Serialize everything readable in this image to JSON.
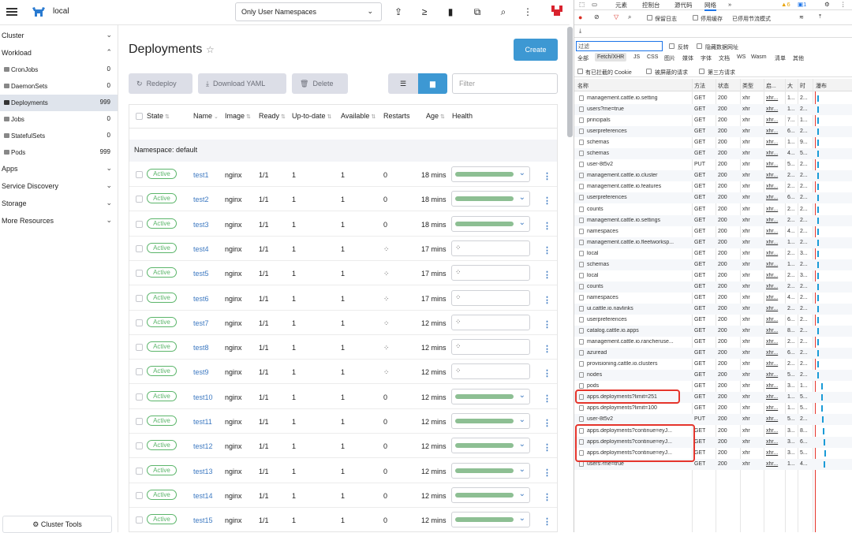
{
  "topbar": {
    "cluster_name": "local",
    "namespace_filter": "Only User Namespaces",
    "icons": [
      "upload-icon",
      "terminal-icon",
      "file-icon",
      "copy-icon",
      "search-icon",
      "more-vertical-icon"
    ]
  },
  "sidebar": {
    "groups": [
      {
        "label": "Cluster",
        "chevron": "⌄"
      },
      {
        "label": "Workload",
        "chevron": "⌃"
      },
      {
        "label": "Apps",
        "chevron": "⌄"
      },
      {
        "label": "Service Discovery",
        "chevron": "⌄"
      },
      {
        "label": "Storage",
        "chevron": "⌄"
      },
      {
        "label": "More Resources",
        "chevron": "⌄"
      }
    ],
    "items": [
      {
        "label": "CronJobs",
        "count": "0"
      },
      {
        "label": "DaemonSets",
        "count": "0"
      },
      {
        "label": "Deployments",
        "count": "999"
      },
      {
        "label": "Jobs",
        "count": "0"
      },
      {
        "label": "StatefulSets",
        "count": "0"
      },
      {
        "label": "Pods",
        "count": "999"
      }
    ],
    "cluster_tools": "Cluster Tools"
  },
  "main": {
    "title": "Deployments",
    "star": "☆",
    "create_label": "Create",
    "redeploy_label": "Redeploy",
    "download_label": "Download YAML",
    "delete_label": "Delete",
    "filter_placeholder": "Filter",
    "columns": [
      "State",
      "Name",
      "Image",
      "Ready",
      "Up-to-date",
      "Available",
      "Restarts",
      "Age",
      "Health"
    ],
    "namespace_label": "Namespace:",
    "namespace_value": "default",
    "rows": [
      {
        "state": "Active",
        "name": "test1",
        "image": "nginx",
        "ready": "1/1",
        "uptodate": "1",
        "available": "1",
        "restarts": "0",
        "age": "18 mins",
        "healthy": true
      },
      {
        "state": "Active",
        "name": "test2",
        "image": "nginx",
        "ready": "1/1",
        "uptodate": "1",
        "available": "1",
        "restarts": "0",
        "age": "18 mins",
        "healthy": true
      },
      {
        "state": "Active",
        "name": "test3",
        "image": "nginx",
        "ready": "1/1",
        "uptodate": "1",
        "available": "1",
        "restarts": "0",
        "age": "18 mins",
        "healthy": true
      },
      {
        "state": "Active",
        "name": "test4",
        "image": "nginx",
        "ready": "1/1",
        "uptodate": "1",
        "available": "1",
        "restarts": "",
        "age": "17 mins",
        "healthy": false
      },
      {
        "state": "Active",
        "name": "test5",
        "image": "nginx",
        "ready": "1/1",
        "uptodate": "1",
        "available": "1",
        "restarts": "",
        "age": "17 mins",
        "healthy": false
      },
      {
        "state": "Active",
        "name": "test6",
        "image": "nginx",
        "ready": "1/1",
        "uptodate": "1",
        "available": "1",
        "restarts": "",
        "age": "17 mins",
        "healthy": false
      },
      {
        "state": "Active",
        "name": "test7",
        "image": "nginx",
        "ready": "1/1",
        "uptodate": "1",
        "available": "1",
        "restarts": "",
        "age": "12 mins",
        "healthy": false
      },
      {
        "state": "Active",
        "name": "test8",
        "image": "nginx",
        "ready": "1/1",
        "uptodate": "1",
        "available": "1",
        "restarts": "",
        "age": "12 mins",
        "healthy": false
      },
      {
        "state": "Active",
        "name": "test9",
        "image": "nginx",
        "ready": "1/1",
        "uptodate": "1",
        "available": "1",
        "restarts": "",
        "age": "12 mins",
        "healthy": false
      },
      {
        "state": "Active",
        "name": "test10",
        "image": "nginx",
        "ready": "1/1",
        "uptodate": "1",
        "available": "1",
        "restarts": "0",
        "age": "12 mins",
        "healthy": true
      },
      {
        "state": "Active",
        "name": "test11",
        "image": "nginx",
        "ready": "1/1",
        "uptodate": "1",
        "available": "1",
        "restarts": "0",
        "age": "12 mins",
        "healthy": true
      },
      {
        "state": "Active",
        "name": "test12",
        "image": "nginx",
        "ready": "1/1",
        "uptodate": "1",
        "available": "1",
        "restarts": "0",
        "age": "12 mins",
        "healthy": true
      },
      {
        "state": "Active",
        "name": "test13",
        "image": "nginx",
        "ready": "1/1",
        "uptodate": "1",
        "available": "1",
        "restarts": "0",
        "age": "12 mins",
        "healthy": true
      },
      {
        "state": "Active",
        "name": "test14",
        "image": "nginx",
        "ready": "1/1",
        "uptodate": "1",
        "available": "1",
        "restarts": "0",
        "age": "12 mins",
        "healthy": true
      },
      {
        "state": "Active",
        "name": "test15",
        "image": "nginx",
        "ready": "1/1",
        "uptodate": "1",
        "available": "1",
        "restarts": "0",
        "age": "12 mins",
        "healthy": true
      }
    ]
  },
  "devtools": {
    "tabs": [
      "元素",
      "控制台",
      "源代码",
      "网络",
      "»"
    ],
    "badges": {
      "warnings": "6",
      "messages": "1"
    },
    "toolbar": {
      "preserve_log": "保留日志",
      "disable_cache": "停用缓存",
      "throttle": "已停用节流模式"
    },
    "filter_placeholder": "过滤",
    "invert": "反转",
    "hide_data_urls": "隐藏数据网址",
    "types": [
      "全部",
      "Fetch/XHR",
      "JS",
      "CSS",
      "图片",
      "媒体",
      "字体",
      "文档",
      "WS",
      "Wasm",
      "清单",
      "其他"
    ],
    "blocked_cookies": "有已拦截的 Cookie",
    "blocked_requests": "被屏蔽的请求",
    "third_party": "第三方请求",
    "columns": [
      "名称",
      "方法",
      "状态",
      "类型",
      "启...",
      "大",
      "时",
      "瀑布"
    ],
    "requests": [
      {
        "name": "management.cattle.io.setting",
        "method": "GET",
        "status": "200",
        "type": "xhr",
        "init": "xhr...",
        "size": "1...",
        "time": "2..."
      },
      {
        "name": "users?me=true",
        "method": "GET",
        "status": "200",
        "type": "xhr",
        "init": "xhr...",
        "size": "1...",
        "time": "2..."
      },
      {
        "name": "principals",
        "method": "GET",
        "status": "200",
        "type": "xhr",
        "init": "xhr...",
        "size": "7...",
        "time": "1..."
      },
      {
        "name": "userpreferences",
        "method": "GET",
        "status": "200",
        "type": "xhr",
        "init": "xhr...",
        "size": "6...",
        "time": "2..."
      },
      {
        "name": "schemas",
        "method": "GET",
        "status": "200",
        "type": "xhr",
        "init": "xhr...",
        "size": "1...",
        "time": "9..."
      },
      {
        "name": "schemas",
        "method": "GET",
        "status": "200",
        "type": "xhr",
        "init": "xhr...",
        "size": "4...",
        "time": "5..."
      },
      {
        "name": "user-8t5v2",
        "method": "PUT",
        "status": "200",
        "type": "xhr",
        "init": "xhr...",
        "size": "5...",
        "time": "2..."
      },
      {
        "name": "management.cattle.io.cluster",
        "method": "GET",
        "status": "200",
        "type": "xhr",
        "init": "xhr...",
        "size": "2...",
        "time": "2..."
      },
      {
        "name": "management.cattle.io.features",
        "method": "GET",
        "status": "200",
        "type": "xhr",
        "init": "xhr...",
        "size": "2...",
        "time": "2..."
      },
      {
        "name": "userpreferences",
        "method": "GET",
        "status": "200",
        "type": "xhr",
        "init": "xhr...",
        "size": "6...",
        "time": "2..."
      },
      {
        "name": "counts",
        "method": "GET",
        "status": "200",
        "type": "xhr",
        "init": "xhr...",
        "size": "2...",
        "time": "2..."
      },
      {
        "name": "management.cattle.io.settings",
        "method": "GET",
        "status": "200",
        "type": "xhr",
        "init": "xhr...",
        "size": "2...",
        "time": "2..."
      },
      {
        "name": "namespaces",
        "method": "GET",
        "status": "200",
        "type": "xhr",
        "init": "xhr...",
        "size": "4...",
        "time": "2..."
      },
      {
        "name": "management.cattle.io.fleetworksp...",
        "method": "GET",
        "status": "200",
        "type": "xhr",
        "init": "xhr...",
        "size": "1...",
        "time": "2..."
      },
      {
        "name": "local",
        "method": "GET",
        "status": "200",
        "type": "xhr",
        "init": "xhr...",
        "size": "2...",
        "time": "3..."
      },
      {
        "name": "schemas",
        "method": "GET",
        "status": "200",
        "type": "xhr",
        "init": "xhr...",
        "size": "1...",
        "time": "2..."
      },
      {
        "name": "local",
        "method": "GET",
        "status": "200",
        "type": "xhr",
        "init": "xhr...",
        "size": "2...",
        "time": "3..."
      },
      {
        "name": "counts",
        "method": "GET",
        "status": "200",
        "type": "xhr",
        "init": "xhr...",
        "size": "2...",
        "time": "2..."
      },
      {
        "name": "namespaces",
        "method": "GET",
        "status": "200",
        "type": "xhr",
        "init": "xhr...",
        "size": "4...",
        "time": "2..."
      },
      {
        "name": "ui.cattle.io.navlinks",
        "method": "GET",
        "status": "200",
        "type": "xhr",
        "init": "xhr...",
        "size": "2...",
        "time": "2..."
      },
      {
        "name": "userpreferences",
        "method": "GET",
        "status": "200",
        "type": "xhr",
        "init": "xhr...",
        "size": "6...",
        "time": "2..."
      },
      {
        "name": "catalog.cattle.io.apps",
        "method": "GET",
        "status": "200",
        "type": "xhr",
        "init": "xhr...",
        "size": "8...",
        "time": "2..."
      },
      {
        "name": "management.cattle.io.rancheruse...",
        "method": "GET",
        "status": "200",
        "type": "xhr",
        "init": "xhr...",
        "size": "2...",
        "time": "2..."
      },
      {
        "name": "azuread",
        "method": "GET",
        "status": "200",
        "type": "xhr",
        "init": "xhr...",
        "size": "6...",
        "time": "2..."
      },
      {
        "name": "provisioning.cattle.io.clusters",
        "method": "GET",
        "status": "200",
        "type": "xhr",
        "init": "xhr...",
        "size": "2...",
        "time": "2..."
      },
      {
        "name": "nodes",
        "method": "GET",
        "status": "200",
        "type": "xhr",
        "init": "xhr...",
        "size": "5...",
        "time": "2..."
      },
      {
        "name": "pods",
        "method": "GET",
        "status": "200",
        "type": "xhr",
        "init": "xhr...",
        "size": "3...",
        "time": "1..."
      },
      {
        "name": "apps.deployments?limit=251",
        "method": "GET",
        "status": "200",
        "type": "xhr",
        "init": "xhr...",
        "size": "1...",
        "time": "5..."
      },
      {
        "name": "apps.deployments?limit=100",
        "method": "GET",
        "status": "200",
        "type": "xhr",
        "init": "xhr...",
        "size": "1...",
        "time": "5..."
      },
      {
        "name": "user-8t5v2",
        "method": "PUT",
        "status": "200",
        "type": "xhr",
        "init": "xhr...",
        "size": "5...",
        "time": "2..."
      },
      {
        "name": "apps.deployments?continue=eyJ...",
        "method": "GET",
        "status": "200",
        "type": "xhr",
        "init": "xhr...",
        "size": "3...",
        "time": "8..."
      },
      {
        "name": "apps.deployments?continue=eyJ...",
        "method": "GET",
        "status": "200",
        "type": "xhr",
        "init": "xhr...",
        "size": "3...",
        "time": "6..."
      },
      {
        "name": "apps.deployments?continue=eyJ...",
        "method": "GET",
        "status": "200",
        "type": "xhr",
        "init": "xhr...",
        "size": "3...",
        "time": "5..."
      },
      {
        "name": "users?me=true",
        "method": "GET",
        "status": "200",
        "type": "xhr",
        "init": "xhr...",
        "size": "1...",
        "time": "4..."
      }
    ]
  },
  "colors": {
    "accent": "#3d98d3",
    "active": "#5bb56a",
    "link": "#3d79c1",
    "highlight": "#e5352c"
  }
}
